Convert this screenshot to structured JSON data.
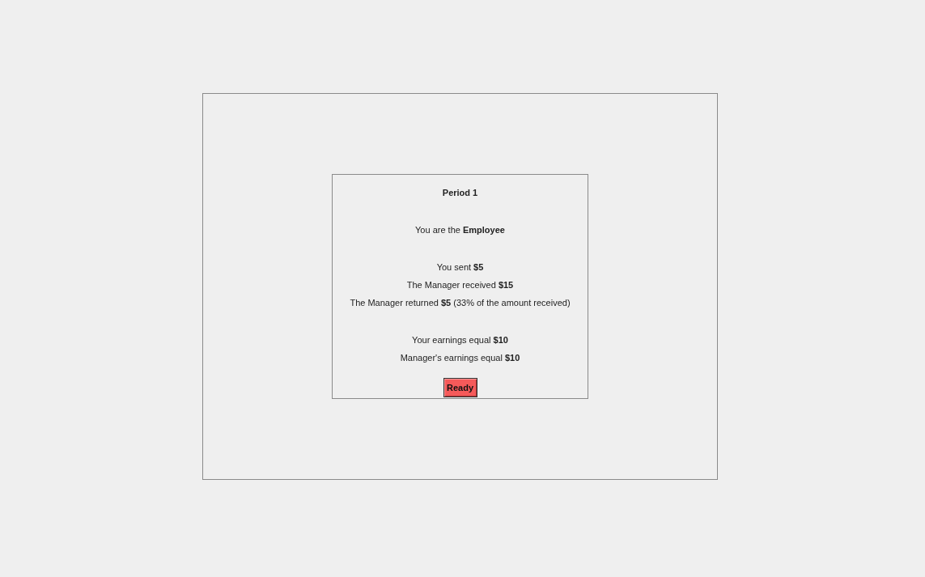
{
  "title": "Period 1",
  "role": "You are the **Employee**",
  "groups": [
    [
      "You sent **$5**",
      "The Manager received **$15**",
      "The Manager returned **$5** (33% of the amount received)"
    ],
    [
      "Your earnings equal **$10**",
      "Manager's earnings equal **$10**"
    ]
  ],
  "button": "Ready"
}
